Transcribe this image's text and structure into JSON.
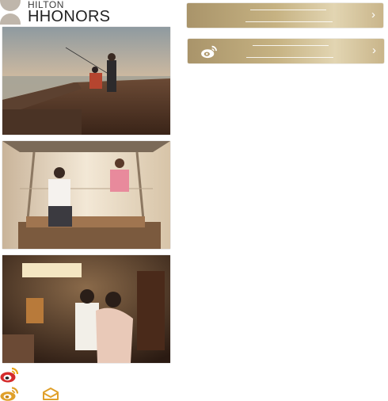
{
  "logo": {
    "line1": "HILTON",
    "line2": "HHONORS"
  },
  "buttons": [
    {
      "label": "",
      "icon": "none",
      "chevron": "›"
    },
    {
      "label": "",
      "icon": "weibo-icon",
      "chevron": "›"
    }
  ],
  "photos": [
    {
      "name": "seaside-deck-photo"
    },
    {
      "name": "lounge-window-photo"
    },
    {
      "name": "hotel-room-couple-photo"
    }
  ],
  "footer_icons": [
    "weibo-icon",
    "weibo-icon",
    "mail-icon"
  ],
  "colors": {
    "gold_dark": "#a9946a",
    "gold_light": "#e2d5b2",
    "weibo_red": "#d52b2b",
    "weibo_gold": "#e8a317"
  }
}
